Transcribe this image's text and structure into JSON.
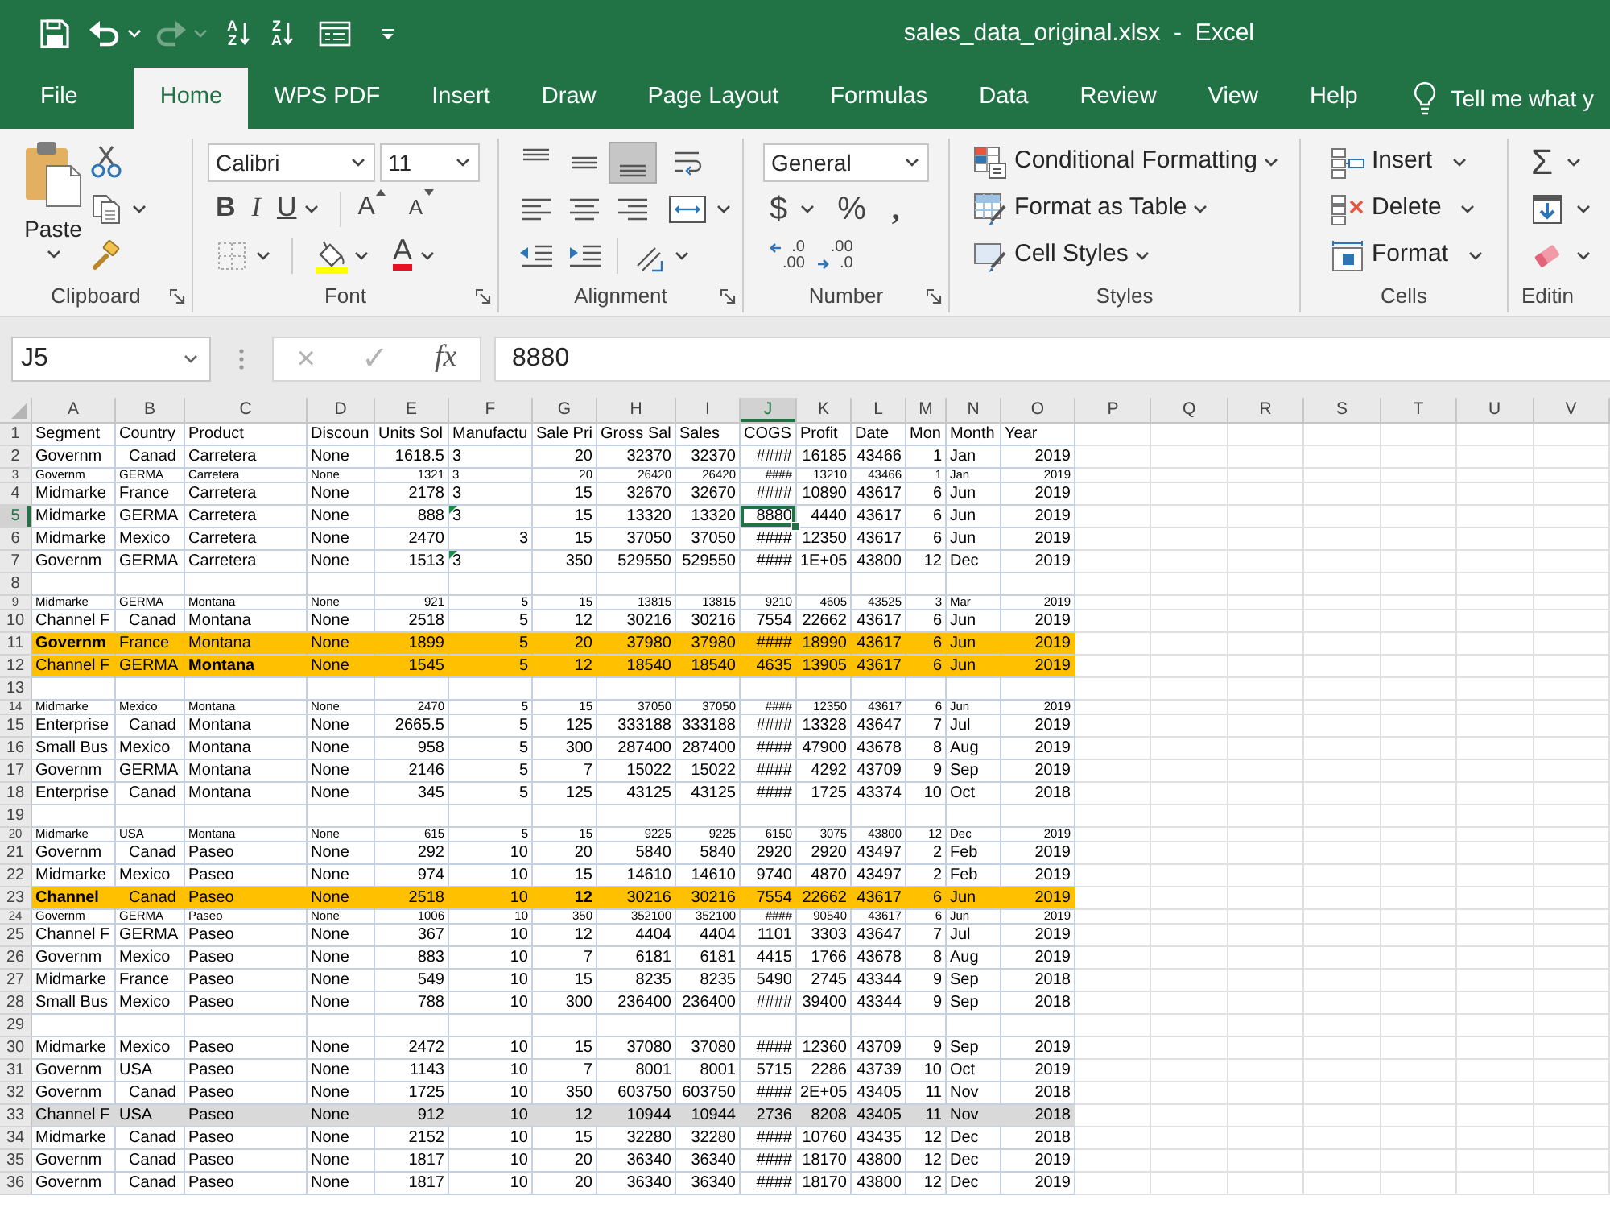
{
  "title_bar": {
    "quick_access": [
      {
        "disabled": false
      },
      {
        "disabled": false
      },
      {
        "disabled": true
      }
    ],
    "sort_buttons": [
      [
        "A",
        "Z"
      ],
      [
        "Z",
        "A"
      ]
    ],
    "title": "sales_data_original.xlsx  -  Excel"
  },
  "tabs": [
    {
      "label": "File",
      "selected": false
    },
    {
      "label": "Home",
      "selected": true
    },
    {
      "label": "WPS PDF",
      "selected": false
    },
    {
      "label": "Insert",
      "selected": false
    },
    {
      "label": "Draw",
      "selected": false
    },
    {
      "label": "Page Layout",
      "selected": false
    },
    {
      "label": "Formulas",
      "selected": false
    },
    {
      "label": "Data",
      "selected": false
    },
    {
      "label": "Review",
      "selected": false
    },
    {
      "label": "View",
      "selected": false
    },
    {
      "label": "Help",
      "selected": false
    }
  ],
  "tell_me": "Tell me what y",
  "ribbon": {
    "clipboard": {
      "label": "Clipboard",
      "paste": "Paste"
    },
    "font": {
      "label": "Font",
      "combos": [
        "Calibri",
        "11"
      ],
      "styles": [
        "B",
        "I",
        "U"
      ],
      "grow": "A",
      "shrink": "A",
      "font_color": "A"
    },
    "alignment": {
      "label": "Alignment",
      "buttons": [
        {
          "on": false
        },
        {
          "on": false
        },
        {
          "on": true
        },
        {
          "on": false
        },
        {
          "on": false
        },
        {
          "on": false
        },
        {
          "on": false
        },
        {
          "on": false
        },
        {
          "on": false
        },
        {
          "on": false
        },
        {
          "on": false
        }
      ]
    },
    "number": {
      "label": "Number",
      "format": "General",
      "currency": "$",
      "percent": "%",
      "comma": ",",
      "decimals": [
        [
          ".0",
          ".00"
        ],
        [
          ".00",
          ".0"
        ]
      ]
    },
    "styles": {
      "label": "Styles",
      "items": [
        "Conditional Formatting",
        "Format as Table",
        "Cell Styles"
      ]
    },
    "cells": {
      "label": "Cells",
      "items": [
        "Insert",
        "Delete",
        "Format"
      ]
    },
    "editing": {
      "label": "Editin",
      "autosum": "Σ"
    }
  },
  "formula_bar": {
    "name_box": "J5",
    "cancel": {
      "label": "×",
      "disabled": true
    },
    "enter": {
      "label": "✓",
      "disabled": true
    },
    "fx": "fx",
    "formula": "8880"
  },
  "sheet": {
    "columns": [
      {
        "letter": "A",
        "kind": "text",
        "selected": false
      },
      {
        "letter": "B",
        "kind": "text",
        "selected": false
      },
      {
        "letter": "C",
        "kind": "text",
        "selected": false
      },
      {
        "letter": "D",
        "kind": "text",
        "selected": false
      },
      {
        "letter": "E",
        "kind": "number",
        "selected": false
      },
      {
        "letter": "F",
        "kind": "number",
        "selected": false
      },
      {
        "letter": "G",
        "kind": "number",
        "selected": false
      },
      {
        "letter": "H",
        "kind": "number",
        "selected": false
      },
      {
        "letter": "I",
        "kind": "number",
        "selected": false
      },
      {
        "letter": "J",
        "kind": "number",
        "selected": true
      },
      {
        "letter": "K",
        "kind": "number",
        "selected": false
      },
      {
        "letter": "L",
        "kind": "number",
        "selected": false
      },
      {
        "letter": "M",
        "kind": "number",
        "selected": false
      },
      {
        "letter": "N",
        "kind": "text",
        "selected": false
      },
      {
        "letter": "O",
        "kind": "number",
        "selected": false
      },
      {
        "letter": "P",
        "selected": false
      },
      {
        "letter": "Q",
        "selected": false
      },
      {
        "letter": "R",
        "selected": false
      },
      {
        "letter": "S",
        "selected": false
      },
      {
        "letter": "T",
        "selected": false
      },
      {
        "letter": "U",
        "selected": false
      },
      {
        "letter": "V",
        "selected": false
      }
    ],
    "rows": [
      {
        "number": "1",
        "kind": "header",
        "selected": false,
        "cells": [
          "Segment",
          "Country",
          "Product",
          "Discoun",
          "Units Sol",
          "Manufactu",
          "Sale Pri",
          "Gross Sal",
          "Sales",
          "COGS",
          "Profit",
          "Date",
          "Mon",
          "Month",
          "Year"
        ]
      },
      {
        "number": "2",
        "kind": "normal",
        "selected": false,
        "cells": [
          "Governm",
          {
            "text": "Canad",
            "kind": "indented"
          },
          "Carretera",
          "None",
          "1618.5",
          {
            "text": "3",
            "kind": "text"
          },
          "20",
          "32370",
          "32370",
          "####",
          "16185",
          "43466",
          "1",
          "Jan",
          "2019"
        ]
      },
      {
        "number": "3",
        "kind": "squashed",
        "selected": false,
        "cells": [
          "Governm",
          "GERMA",
          "Carretera",
          "None",
          "1321",
          {
            "text": "3",
            "kind": "text"
          },
          "20",
          "26420",
          "26420",
          "####",
          "13210",
          "43466",
          "1",
          "Jan",
          "2019"
        ]
      },
      {
        "number": "4",
        "kind": "normal",
        "selected": false,
        "cells": [
          "Midmarke",
          "France",
          "Carretera",
          "None",
          "2178",
          {
            "text": "3",
            "kind": "text"
          },
          "15",
          "32670",
          "32670",
          "####",
          "10890",
          "43617",
          "6",
          "Jun",
          "2019"
        ]
      },
      {
        "number": "5",
        "kind": "normal",
        "selected": true,
        "cells": [
          "Midmarke",
          "GERMA",
          "Carretera",
          "None",
          "888",
          {
            "text": "3",
            "kind": "text",
            "warning": true
          },
          "15",
          "13320",
          "13320",
          "8880",
          "4440",
          "43617",
          "6",
          "Jun",
          "2019"
        ]
      },
      {
        "number": "6",
        "kind": "normal",
        "selected": false,
        "cells": [
          "Midmarke",
          "Mexico",
          "Carretera",
          "None",
          "2470",
          "3",
          "15",
          "37050",
          "37050",
          "####",
          "12350",
          "43617",
          "6",
          "Jun",
          "2019"
        ]
      },
      {
        "number": "7",
        "kind": "normal",
        "selected": false,
        "cells": [
          "Governm",
          "GERMA",
          "Carretera",
          "None",
          "1513",
          {
            "text": "3",
            "kind": "text",
            "warning": true
          },
          "350",
          "529550",
          "529550",
          "####",
          "1E+05",
          "43800",
          "12",
          "Dec",
          "2019"
        ]
      },
      {
        "number": "8",
        "kind": "normal",
        "selected": false,
        "cells": []
      },
      {
        "number": "9",
        "kind": "squashed",
        "selected": false,
        "cells": [
          "Midmarke",
          "GERMA",
          "Montana",
          "None",
          "921",
          "5",
          "15",
          "13815",
          "13815",
          "9210",
          "4605",
          "43525",
          "3",
          "Mar",
          "2019"
        ]
      },
      {
        "number": "10",
        "kind": "normal",
        "selected": false,
        "cells": [
          "Channel F",
          {
            "text": "Canad",
            "kind": "indented"
          },
          "Montana",
          "None",
          "2518",
          "5",
          "12",
          "30216",
          "30216",
          "7554",
          "22662",
          "43617",
          "6",
          "Jun",
          "2019"
        ]
      },
      {
        "number": "11",
        "kind": "normal",
        "selected": false,
        "color": "#ffc000",
        "cells": [
          {
            "text": "Governm",
            "bold": true
          },
          "France",
          "Montana",
          "None",
          "1899",
          "5",
          "20",
          "37980",
          "37980",
          "####",
          "18990",
          "43617",
          "6",
          "Jun",
          "2019"
        ]
      },
      {
        "number": "12",
        "kind": "normal",
        "selected": false,
        "color": "#ffc000",
        "cells": [
          "Channel F",
          "GERMA",
          {
            "text": "Montana",
            "bold": true
          },
          "None",
          "1545",
          "5",
          "12",
          "18540",
          "18540",
          "4635",
          "13905",
          "43617",
          "6",
          "Jun",
          "2019"
        ]
      },
      {
        "number": "13",
        "kind": "normal",
        "selected": false,
        "cells": []
      },
      {
        "number": "14",
        "kind": "squashed",
        "selected": false,
        "cells": [
          "Midmarke",
          "Mexico",
          "Montana",
          "None",
          "2470",
          "5",
          "15",
          "37050",
          "37050",
          "####",
          "12350",
          "43617",
          "6",
          "Jun",
          "2019"
        ]
      },
      {
        "number": "15",
        "kind": "normal",
        "selected": false,
        "cells": [
          "Enterprise",
          {
            "text": "Canad",
            "kind": "indented"
          },
          "Montana",
          "None",
          "2665.5",
          "5",
          "125",
          "333188",
          "333188",
          "####",
          "13328",
          "43647",
          "7",
          "Jul",
          "2019"
        ]
      },
      {
        "number": "16",
        "kind": "normal",
        "selected": false,
        "cells": [
          "Small Bus",
          "Mexico",
          "Montana",
          "None",
          "958",
          "5",
          "300",
          "287400",
          "287400",
          "####",
          "47900",
          "43678",
          "8",
          "Aug",
          "2019"
        ]
      },
      {
        "number": "17",
        "kind": "normal",
        "selected": false,
        "cells": [
          "Governm",
          "GERMA",
          "Montana",
          "None",
          "2146",
          "5",
          "7",
          "15022",
          "15022",
          "####",
          "4292",
          "43709",
          "9",
          "Sep",
          "2019"
        ]
      },
      {
        "number": "18",
        "kind": "normal",
        "selected": false,
        "cells": [
          "Enterprise",
          {
            "text": "Canad",
            "kind": "indented"
          },
          "Montana",
          "None",
          "345",
          "5",
          "125",
          "43125",
          "43125",
          "####",
          "1725",
          "43374",
          "10",
          "Oct",
          "2018"
        ]
      },
      {
        "number": "19",
        "kind": "normal",
        "selected": false,
        "cells": []
      },
      {
        "number": "20",
        "kind": "squashed",
        "selected": false,
        "cells": [
          "Midmarke",
          "USA",
          "Montana",
          "None",
          "615",
          "5",
          "15",
          "9225",
          "9225",
          "6150",
          "3075",
          "43800",
          "12",
          "Dec",
          "2019"
        ]
      },
      {
        "number": "21",
        "kind": "normal",
        "selected": false,
        "cells": [
          "Governm",
          {
            "text": "Canad",
            "kind": "indented"
          },
          "Paseo",
          "None",
          "292",
          "10",
          "20",
          "5840",
          "5840",
          "2920",
          "2920",
          "43497",
          "2",
          "Feb",
          "2019"
        ]
      },
      {
        "number": "22",
        "kind": "normal",
        "selected": false,
        "cells": [
          "Midmarke",
          "Mexico",
          "Paseo",
          "None",
          "974",
          "10",
          "15",
          "14610",
          "14610",
          "9740",
          "4870",
          "43497",
          "2",
          "Feb",
          "2019"
        ]
      },
      {
        "number": "23",
        "kind": "normal",
        "selected": false,
        "color": "#ffc000",
        "cells": [
          {
            "text": "Channel",
            "bold": true
          },
          {
            "text": "Canad",
            "kind": "indented"
          },
          "Paseo",
          "None",
          "2518",
          "10",
          {
            "text": "12",
            "bold": true
          },
          "30216",
          "30216",
          "7554",
          "22662",
          "43617",
          "6",
          "Jun",
          "2019"
        ]
      },
      {
        "number": "24",
        "kind": "squashed",
        "selected": false,
        "cells": [
          "Governm",
          "GERMA",
          "Paseo",
          "None",
          "1006",
          "10",
          "350",
          "352100",
          "352100",
          "####",
          "90540",
          "43617",
          "6",
          "Jun",
          "2019"
        ]
      },
      {
        "number": "25",
        "kind": "normal",
        "selected": false,
        "cells": [
          "Channel F",
          "GERMA",
          "Paseo",
          "None",
          "367",
          "10",
          "12",
          "4404",
          "4404",
          "1101",
          "3303",
          "43647",
          "7",
          "Jul",
          "2019"
        ]
      },
      {
        "number": "26",
        "kind": "normal",
        "selected": false,
        "cells": [
          "Governm",
          "Mexico",
          "Paseo",
          "None",
          "883",
          "10",
          "7",
          "6181",
          "6181",
          "4415",
          "1766",
          "43678",
          "8",
          "Aug",
          "2019"
        ]
      },
      {
        "number": "27",
        "kind": "normal",
        "selected": false,
        "cells": [
          "Midmarke",
          "France",
          "Paseo",
          "None",
          "549",
          "10",
          "15",
          "8235",
          "8235",
          "5490",
          "2745",
          "43344",
          "9",
          "Sep",
          "2018"
        ]
      },
      {
        "number": "28",
        "kind": "normal",
        "selected": false,
        "cells": [
          "Small Bus",
          "Mexico",
          "Paseo",
          "None",
          "788",
          "10",
          "300",
          "236400",
          "236400",
          "####",
          "39400",
          "43344",
          "9",
          "Sep",
          "2018"
        ]
      },
      {
        "number": "29",
        "kind": "normal",
        "selected": false,
        "cells": []
      },
      {
        "number": "30",
        "kind": "normal",
        "selected": false,
        "cells": [
          "Midmarke",
          "Mexico",
          "Paseo",
          "None",
          "2472",
          "10",
          "15",
          "37080",
          "37080",
          "####",
          "12360",
          "43709",
          "9",
          "Sep",
          "2019"
        ]
      },
      {
        "number": "31",
        "kind": "normal",
        "selected": false,
        "cells": [
          "Governm",
          "USA",
          "Paseo",
          "None",
          "1143",
          "10",
          "7",
          "8001",
          "8001",
          "5715",
          "2286",
          "43739",
          "10",
          "Oct",
          "2019"
        ]
      },
      {
        "number": "32",
        "kind": "normal",
        "selected": false,
        "cells": [
          "Governm",
          {
            "text": "Canad",
            "kind": "indented"
          },
          "Paseo",
          "None",
          "1725",
          "10",
          "350",
          "603750",
          "603750",
          "####",
          "2E+05",
          "43405",
          "11",
          "Nov",
          "2018"
        ]
      },
      {
        "number": "33",
        "kind": "normal",
        "selected": false,
        "color": "#d9d9d9",
        "cells": [
          "Channel F",
          "USA",
          "Paseo",
          "None",
          "912",
          "10",
          "12",
          "10944",
          "10944",
          "2736",
          "8208",
          "43405",
          "11",
          "Nov",
          "2018"
        ]
      },
      {
        "number": "34",
        "kind": "normal",
        "selected": false,
        "cells": [
          "Midmarke",
          {
            "text": "Canad",
            "kind": "indented"
          },
          "Paseo",
          "None",
          "2152",
          "10",
          "15",
          "32280",
          "32280",
          "####",
          "10760",
          "43435",
          "12",
          "Dec",
          "2018"
        ]
      },
      {
        "number": "35",
        "kind": "normal",
        "selected": false,
        "cells": [
          "Governm",
          {
            "text": "Canad",
            "kind": "indented"
          },
          "Paseo",
          "None",
          "1817",
          "10",
          "20",
          "36340",
          "36340",
          "####",
          "18170",
          "43800",
          "12",
          "Dec",
          "2019"
        ]
      },
      {
        "number": "36",
        "kind": "normal",
        "selected": false,
        "cells": [
          "Governm",
          {
            "text": "Canad",
            "kind": "indented"
          },
          "Paseo",
          "None",
          "1817",
          "10",
          "20",
          "36340",
          "36340",
          "####",
          "18170",
          "43800",
          "12",
          "Dec",
          "2019"
        ]
      }
    ]
  }
}
